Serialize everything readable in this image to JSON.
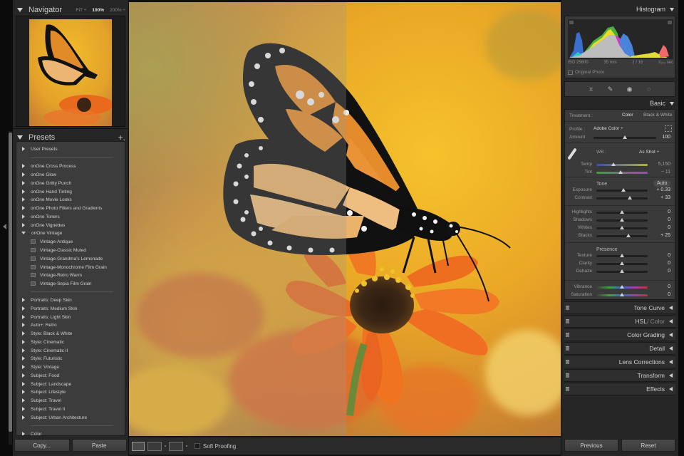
{
  "navigator": {
    "title": "Navigator",
    "zoom_options": [
      "FIT ÷",
      "100%",
      "200% ÷"
    ],
    "selected_zoom": "100%"
  },
  "presets": {
    "title": "Presets",
    "add_label": "+.",
    "groups_top": [
      {
        "label": "User Presets",
        "expanded": false
      }
    ],
    "groups_onone": [
      {
        "label": "onOne Cross Process",
        "expanded": false
      },
      {
        "label": "onOne Glow",
        "expanded": false
      },
      {
        "label": "onOne Gritty Punch",
        "expanded": false
      },
      {
        "label": "onOne Hand Tinting",
        "expanded": false
      },
      {
        "label": "onOne Movie Looks",
        "expanded": false
      },
      {
        "label": "onOne Photo Filters and Gradients",
        "expanded": false
      },
      {
        "label": "onOne Toners",
        "expanded": false
      },
      {
        "label": "onOne Vignettes",
        "expanded": false
      },
      {
        "label": "onOne Vintage",
        "expanded": true
      }
    ],
    "vintage_items": [
      "Vintage-Antique",
      "Vintage-Classic Muted",
      "Vintage-Grandma's Lemonade",
      "Vintage-Monochrome Film Grain",
      "Vintage-Retro Warm",
      "Vintage-Sepia Film Grain"
    ],
    "groups_style": [
      "Portraits: Deep Skin",
      "Portraits: Medium Skin",
      "Portraits: Light Skin",
      "Auto+: Retro",
      "Style: Black & White",
      "Style: Cinematic",
      "Style: Cinematic II",
      "Style: Futuristic",
      "Style: Vintage",
      "Subject: Food",
      "Subject: Landscape",
      "Subject: Lifestyle",
      "Subject: Travel",
      "Subject: Travel II",
      "Subject: Urban Architecture"
    ],
    "groups_bottom": [
      "Color"
    ]
  },
  "left_buttons": {
    "copy": "Copy...",
    "paste": "Paste"
  },
  "toolbar": {
    "soft_proofing_label": "Soft Proofing",
    "soft_proofing_checked": false,
    "view_icons": [
      "loupe-view-icon",
      "before-after-lr-icon",
      "before-after-yy-icon"
    ]
  },
  "histogram": {
    "title": "Histogram",
    "iso": "ISO 25600",
    "focal": "35 mm",
    "aperture": "ƒ / 16",
    "shutter": "¹⁄₁₀₀ sec",
    "original_photo_label": "Original Photo"
  },
  "tools": [
    "crop-icon",
    "healing-icon",
    "red-eye-icon",
    "masking-icon"
  ],
  "basic": {
    "title": "Basic",
    "treatment_label": "Treatment :",
    "treatment_color": "Color",
    "treatment_bw": "Black & White",
    "profile_label": "Profile :",
    "profile_value": "Adobe Color ÷",
    "amount_label": "Amount",
    "amount_value": "100",
    "wb_label": "WB :",
    "wb_value": "As Shot ÷",
    "temp_label": "Temp",
    "temp_value": "5,150",
    "tint_label": "Tint",
    "tint_value": "− 11",
    "tone_label": "Tone",
    "auto_label": "Auto",
    "sliders_tone": [
      {
        "label": "Exposure",
        "value": "+ 0.33",
        "pos": 0.53
      },
      {
        "label": "Contrast",
        "value": "+ 33",
        "pos": 0.65
      }
    ],
    "sliders_tone2": [
      {
        "label": "Highlights",
        "value": "0",
        "pos": 0.5
      },
      {
        "label": "Shadows",
        "value": "0",
        "pos": 0.5
      },
      {
        "label": "Whites",
        "value": "0",
        "pos": 0.5
      },
      {
        "label": "Blacks",
        "value": "+ 25",
        "pos": 0.62
      }
    ],
    "presence_label": "Presence",
    "sliders_presence": [
      {
        "label": "Texture",
        "value": "0",
        "pos": 0.5
      },
      {
        "label": "Clarity",
        "value": "0",
        "pos": 0.5
      },
      {
        "label": "Dehaze",
        "value": "0",
        "pos": 0.5
      }
    ],
    "sliders_color": [
      {
        "label": "Vibrance",
        "value": "0",
        "pos": 0.5
      },
      {
        "label": "Saturation",
        "value": "0",
        "pos": 0.5
      }
    ],
    "amount_pos": 0.5,
    "temp_pos": 0.33,
    "tint_pos": 0.47
  },
  "modules": [
    {
      "label": "Tone Curve"
    },
    {
      "label": "HSL",
      "label2": " / Color"
    },
    {
      "label": "Color Grading"
    },
    {
      "label": "Detail"
    },
    {
      "label": "Lens Corrections"
    },
    {
      "label": "Transform"
    },
    {
      "label": "Effects"
    }
  ],
  "right_buttons": {
    "previous": "Previous",
    "reset": "Reset"
  }
}
